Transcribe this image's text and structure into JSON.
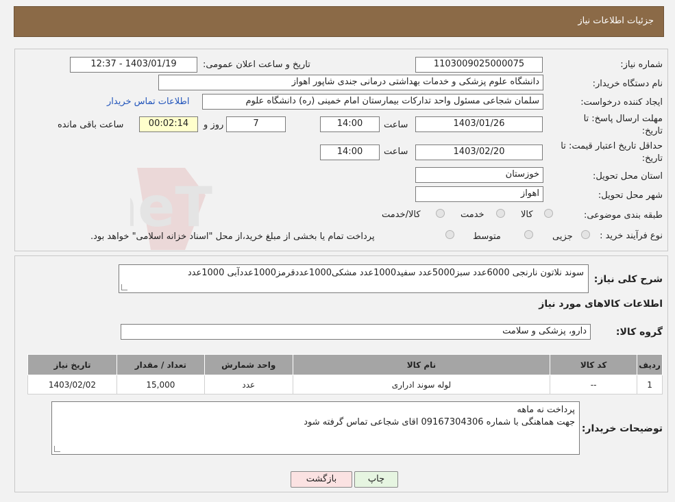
{
  "header": {
    "title": "جزئیات اطلاعات نیاز"
  },
  "form": {
    "need_number_label": "شماره نیاز:",
    "need_number": "1103009025000075",
    "announce_label": "تاریخ و ساعت اعلان عمومی:",
    "announce_value": "1403/01/19 - 12:37",
    "buyer_org_label": "نام دستگاه خریدار:",
    "buyer_org": "دانشگاه علوم پزشکی و خدمات بهداشتی درمانی جندی شاپور اهواز",
    "requester_label": "ایجاد کننده درخواست:",
    "requester": "سلمان شجاعی مسئول واحد تدارکات بیمارستان امام خمینی (ره) دانشگاه علوم",
    "contact_link": "اطلاعات تماس خریدار",
    "deadline_label_1": "مهلت ارسال پاسخ: تا",
    "deadline_label_2": "تاریخ:",
    "deadline_date": "1403/01/26",
    "time_label": "ساعت",
    "deadline_time": "14:00",
    "days_value": "7",
    "days_label": "روز و",
    "remaining_value": "00:02:14",
    "remaining_label": "ساعت باقی مانده",
    "validity_label_1": "حداقل تاریخ اعتبار قیمت: تا",
    "validity_label_2": "تاریخ:",
    "validity_date": "1403/02/20",
    "validity_time": "14:00",
    "province_label": "استان محل تحویل:",
    "province": "خوزستان",
    "city_label": "شهر محل تحویل:",
    "city": "اهواز",
    "category_label": "طبقه بندی موضوعی:",
    "category_options": [
      "کالا",
      "خدمت",
      "کالا/خدمت"
    ],
    "process_label": "نوع فرآیند خرید :",
    "process_options": [
      "جزیی",
      "متوسط"
    ],
    "process_note": "پرداخت تمام یا بخشی از مبلغ خرید،از محل \"اسناد خزانه اسلامی\" خواهد بود."
  },
  "details": {
    "summary_label": "شرح کلی نیاز:",
    "summary": "سوند نلاتون نارنجی 6000عدد سبز5000عدد سفید1000عدد مشکی1000عددقرمز1000عددآبی 1000عدد",
    "goods_info_title": "اطلاعات کالاهای مورد نیاز",
    "goods_group_label": "گروه کالا:",
    "goods_group": "دارو، پزشکی و سلامت",
    "table_headers": [
      "ردیف",
      "کد کالا",
      "نام کالا",
      "واحد شمارش",
      "تعداد / مقدار",
      "تاریخ نیاز"
    ],
    "table_rows": [
      [
        "1",
        "--",
        "لوله سوند ادراری",
        "عدد",
        "15,000",
        "1403/02/02"
      ]
    ],
    "buyer_notes_label": "توضیحات خریدار:",
    "buyer_notes_line1": "پرداخت نه ماهه",
    "buyer_notes_line2": "جهت هماهنگی با شماره 09167304306 اقای شجاعی تماس گرفته شود"
  },
  "buttons": {
    "print": "چاپ",
    "back": "بازگشت"
  },
  "watermark": "AriaTender.neT"
}
